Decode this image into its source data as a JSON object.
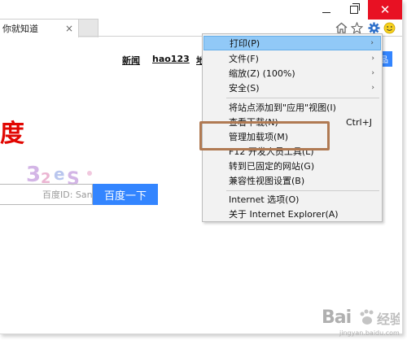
{
  "tab": {
    "title": "你就知道",
    "close_glyph": "×"
  },
  "window": {
    "close_glyph": "✕"
  },
  "page": {
    "nav": [
      "新闻",
      "hao123",
      "地"
    ],
    "login_label": "品",
    "logo_fragment": "度",
    "search_placeholder": "百度ID: Sanpitt",
    "search_button": "百度一下"
  },
  "menu": {
    "items": [
      {
        "label": "打印(P)",
        "arrow": "›",
        "highlighted": true
      },
      {
        "label": "文件(F)",
        "arrow": "›"
      },
      {
        "label": "缩放(Z) (100%)",
        "arrow": "›"
      },
      {
        "label": "安全(S)",
        "arrow": "›"
      },
      {
        "label": "将站点添加到\"应用\"视图(I)"
      },
      {
        "label": "查看下载(N)",
        "shortcut": "Ctrl+J"
      },
      {
        "label": "管理加载项(M)"
      },
      {
        "label": "F12 开发人员工具(L)"
      },
      {
        "label": "转到已固定的网站(G)"
      },
      {
        "label": "兼容性视图设置(B)"
      },
      {
        "label": "Internet 选项(O)"
      },
      {
        "label": "关于 Internet Explorer(A)"
      }
    ]
  },
  "watermark": {
    "text": "Bai",
    "sub": "jingyan.baidu.com"
  },
  "colors": {
    "accent": "#3385ff",
    "close": "#e81123",
    "menu_highlight": "#91c9f7",
    "annotation": "#b07a53",
    "logo_red": "#e10601"
  }
}
